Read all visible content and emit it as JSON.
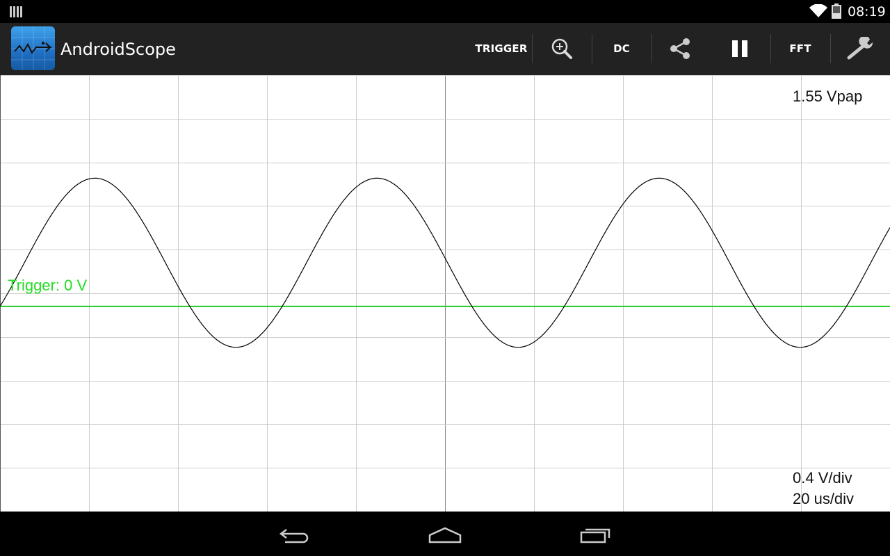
{
  "status_bar": {
    "time": "08:19"
  },
  "action_bar": {
    "app_name": "AndroidScope",
    "trigger_label": "TRIGGER",
    "coupling_label": "DC",
    "fft_label": "FFT",
    "icons": [
      "zoom-in-icon",
      "share-icon",
      "pause-icon",
      "wrench-icon"
    ]
  },
  "scope": {
    "vpp_readout": "1.55 Vpap",
    "volts_per_div": "0.4  V/div",
    "time_per_div": "20 us/div",
    "trigger_text": "Trigger: 0 V",
    "colors": {
      "trace": "#000000",
      "grid": "#cccccc",
      "trigger": "#22cc22"
    }
  },
  "chart_data": {
    "type": "line",
    "title": "",
    "xlabel": "",
    "ylabel": "",
    "grid": true,
    "divisions_x": 10,
    "divisions_y": 10,
    "x_units_per_div": 20,
    "x_unit": "us",
    "y_units_per_div": 0.4,
    "y_unit": "V",
    "series": [
      {
        "amplitude_v": 0.775,
        "offset_v": 0.4,
        "period_us": 63.4,
        "trigger_level_v": 0
      }
    ]
  },
  "nav_bar": {
    "icons": [
      "back-icon",
      "home-icon",
      "recent-apps-icon"
    ]
  }
}
